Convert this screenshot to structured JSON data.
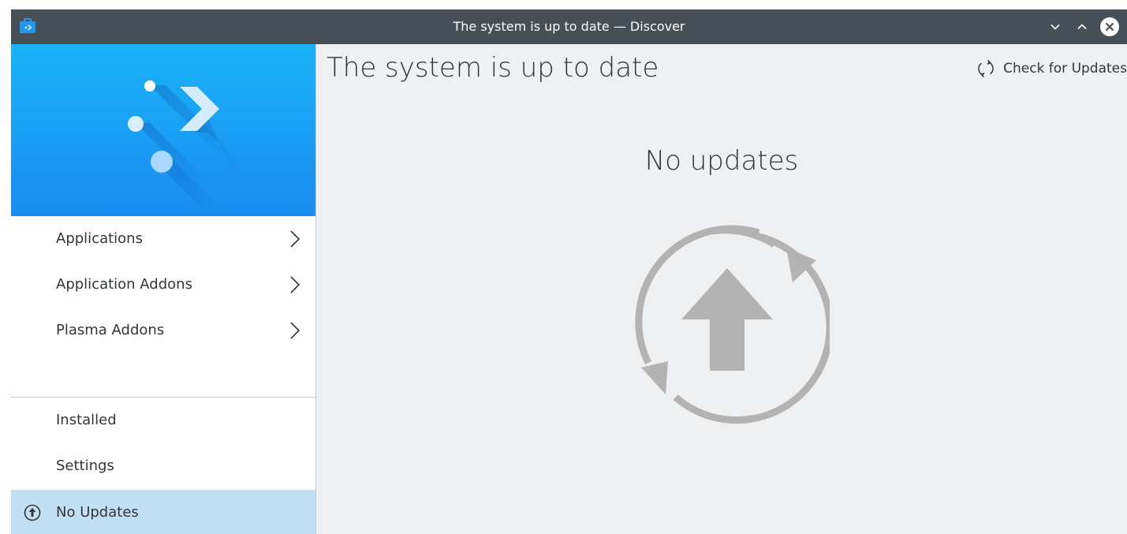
{
  "window": {
    "title": "The system is up to date — Discover"
  },
  "sidebar": {
    "categories": [
      {
        "label": "Applications"
      },
      {
        "label": "Application Addons"
      },
      {
        "label": "Plasma Addons"
      }
    ],
    "bottom_items": [
      {
        "label": "Installed"
      },
      {
        "label": "Settings"
      },
      {
        "label": "No Updates",
        "icon": "update-arrow-icon",
        "selected": true
      }
    ]
  },
  "main": {
    "page_title": "The system is up to date",
    "check_button_label": "Check for Updates",
    "empty_state_text": "No updates"
  },
  "colors": {
    "titlebar": "#475057",
    "hero_top": "#1ab3f8",
    "hero_bottom": "#1a8cf0",
    "selected_item": "#c2e0f5",
    "background": "#eff0f1",
    "icon_gray": "#b3b3b3"
  }
}
